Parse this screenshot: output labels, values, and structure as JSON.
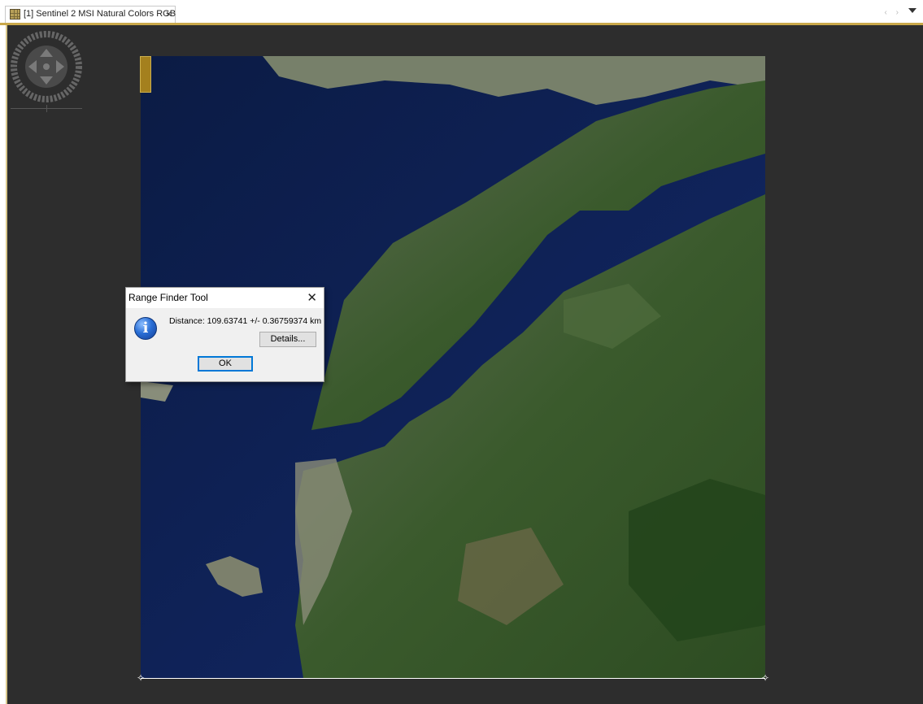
{
  "tab": {
    "label": "[1] Sentinel 2 MSI Natural Colors RGB",
    "close": "×",
    "icon": "raster-image-icon"
  },
  "toolbar": {
    "scroll_arrows": "‹ ›",
    "menu_icon": "dropdown-arrow-icon"
  },
  "navigation": {
    "icon": "pan-navigation-icon",
    "zoom_icon": "zoom-slider-icon"
  },
  "dialog": {
    "title": "Range Finder Tool",
    "close": "✕",
    "message": "Distance: 109.63741 +/- 0.36759374 km",
    "details_label": "Details...",
    "ok_label": "OK",
    "icon": "info-icon"
  },
  "colors": {
    "accent": "#c9a84a",
    "view_background": "#2d2d2d",
    "sea": "#0d1e46",
    "land": "#3a5a2c"
  }
}
